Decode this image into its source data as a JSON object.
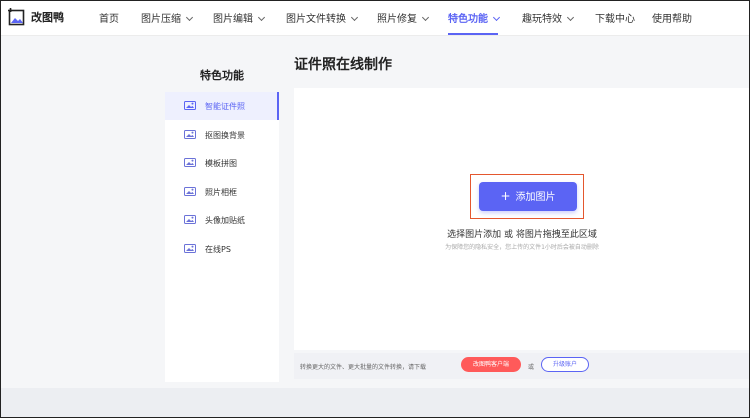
{
  "brand": {
    "name": "改图鸭"
  },
  "nav": {
    "items": [
      {
        "label": "首页",
        "has_dropdown": false
      },
      {
        "label": "图片压缩",
        "has_dropdown": true
      },
      {
        "label": "图片编辑",
        "has_dropdown": true
      },
      {
        "label": "图片文件转换",
        "has_dropdown": true
      },
      {
        "label": "照片修复",
        "has_dropdown": true
      },
      {
        "label": "特色功能",
        "has_dropdown": true,
        "active": true
      },
      {
        "label": "趣玩特效",
        "has_dropdown": true
      },
      {
        "label": "下载中心",
        "has_dropdown": false
      },
      {
        "label": "使用帮助",
        "has_dropdown": false
      }
    ]
  },
  "sidebar": {
    "title": "特色功能",
    "items": [
      {
        "label": "智能证件照",
        "icon": "id-photo-icon",
        "active": true
      },
      {
        "label": "抠图换背景",
        "icon": "cutout-icon"
      },
      {
        "label": "模板拼图",
        "icon": "template-collage-icon"
      },
      {
        "label": "照片相框",
        "icon": "photo-frame-icon"
      },
      {
        "label": "头像加贴纸",
        "icon": "avatar-sticker-icon"
      },
      {
        "label": "在线PS",
        "icon": "online-ps-icon"
      }
    ]
  },
  "main": {
    "title": "证件照在线制作",
    "add_button": "添加图片",
    "hint": "选择图片添加 或 将图片拖拽至此区域",
    "privacy": "为保障您的隐私安全，您上传的文件1小时后会被自动删除"
  },
  "bottom_bar": {
    "text": "转换更大的文件、更大批量的文件转换，请下载",
    "client_button": "改图鸭客户端",
    "or": "或",
    "upgrade_button": "升级账户"
  },
  "colors": {
    "accent": "#5b64f4",
    "highlight_frame": "#e4572e",
    "client_button": "#ff5a5a"
  }
}
